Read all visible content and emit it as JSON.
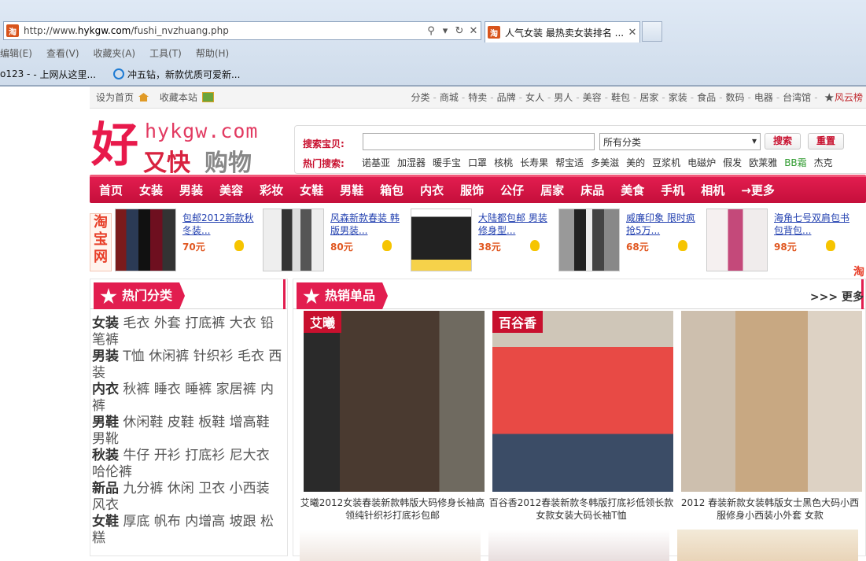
{
  "browser": {
    "url_prefix": "http://www.",
    "url_domain": "hykgw.com",
    "url_path": "/fushi_nvzhuang.php",
    "tab_title": "人气女装 最热卖女装排名 ...",
    "menu": [
      "编辑(E)",
      "查看(V)",
      "收藏夹(A)",
      "工具(T)",
      "帮助(H)"
    ],
    "favorites": [
      "o123 -",
      "- 上网从这里...",
      "冲五钻，新款优质可爱新..."
    ]
  },
  "topbar": {
    "set_home": "设为首页",
    "bookmark": "收藏本站",
    "links": [
      "分类",
      "商城",
      "特卖",
      "品牌",
      "女人",
      "男人",
      "美容",
      "鞋包",
      "居家",
      "家装",
      "食品",
      "数码",
      "电器",
      "台湾馆"
    ],
    "hot_link": "风云榜"
  },
  "logo": {
    "big": "好",
    "domain": "hykgw.com",
    "red_text": "又快",
    "gray_text": "购物"
  },
  "search": {
    "label": "搜索宝贝:",
    "input_value": "",
    "category_selected": "所有分类",
    "search_button": "搜索",
    "reset_button": "重置",
    "hot_label": "热门搜索:",
    "hot_terms": [
      "诺基亚",
      "加湿器",
      "暖手宝",
      "口罩",
      "核桃",
      "长寿果",
      "帮宝适",
      "多美滋",
      "美的",
      "豆浆机",
      "电磁炉",
      "假发",
      "欧莱雅",
      "BB霜",
      "杰克"
    ]
  },
  "nav": [
    "首页",
    "女装",
    "男装",
    "美容",
    "彩妆",
    "女鞋",
    "男鞋",
    "箱包",
    "内衣",
    "服饰",
    "公仔",
    "居家",
    "床品",
    "美食",
    "手机",
    "相机",
    "→更多"
  ],
  "promo": {
    "badge": "淘宝网",
    "mini": "淘",
    "items": [
      {
        "title": "包邮2012新款秋冬装...",
        "price": "70元"
      },
      {
        "title": "风森新款春装 韩版男装...",
        "price": "80元"
      },
      {
        "title": "大陆都包邮 男装修身型...",
        "price": "38元"
      },
      {
        "title": "威廉印象 限时疯抢5万...",
        "price": "68元"
      },
      {
        "title": "海角七号双肩包书包背包...",
        "price": "98元"
      }
    ]
  },
  "hot_categories": {
    "title": "热门分类",
    "rows": [
      {
        "key": "女装",
        "values": "毛衣 外套 打底裤 大衣 铅笔裤"
      },
      {
        "key": "男装",
        "values": "T恤 休闲裤 针织衫 毛衣 西装"
      },
      {
        "key": "内衣",
        "values": "秋裤 睡衣 睡裤 家居裤 内裤"
      },
      {
        "key": "男鞋",
        "values": "休闲鞋 皮鞋 板鞋 增高鞋 男靴"
      },
      {
        "key": "秋装",
        "values": "牛仔 开衫 打底衫 尼大衣 哈伦裤"
      },
      {
        "key": "新品",
        "values": "九分裤 休闲 卫衣 小西装 风衣"
      },
      {
        "key": "女鞋",
        "values": "厚底 帆布 内增高 坡跟 松糕"
      }
    ]
  },
  "best_sellers": {
    "title": "热销单品",
    "more": ">>>   更多",
    "items": [
      {
        "brand": "艾曦",
        "title": "艾曦2012女装春装新款韩版大码修身长袖高领纯针织衫打底衫包邮"
      },
      {
        "brand": "百谷香",
        "title": "百谷香2012春装新款冬韩版打底衫低领长款女款女装大码长袖T恤"
      },
      {
        "brand": "",
        "title": "2012 春装新款女装韩版女士黑色大码小西服修身小西装小外套 女款"
      }
    ]
  }
}
